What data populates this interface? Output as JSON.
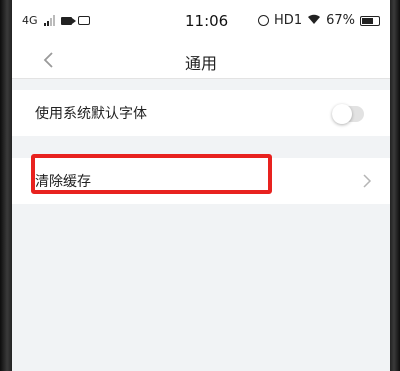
{
  "status_bar": {
    "network": "4G",
    "time": "11:06",
    "hd": "HD1",
    "battery": "67%"
  },
  "nav": {
    "title": "通用",
    "back_icon": "chevron-left-icon"
  },
  "settings": {
    "items": [
      {
        "label": "使用系统默认字体",
        "control": "toggle",
        "toggle_on": false
      },
      {
        "label": "清除缓存",
        "control": "chevron-right-icon"
      }
    ]
  },
  "colors": {
    "highlight": "#e8221f",
    "background": "#f1f3f5"
  }
}
